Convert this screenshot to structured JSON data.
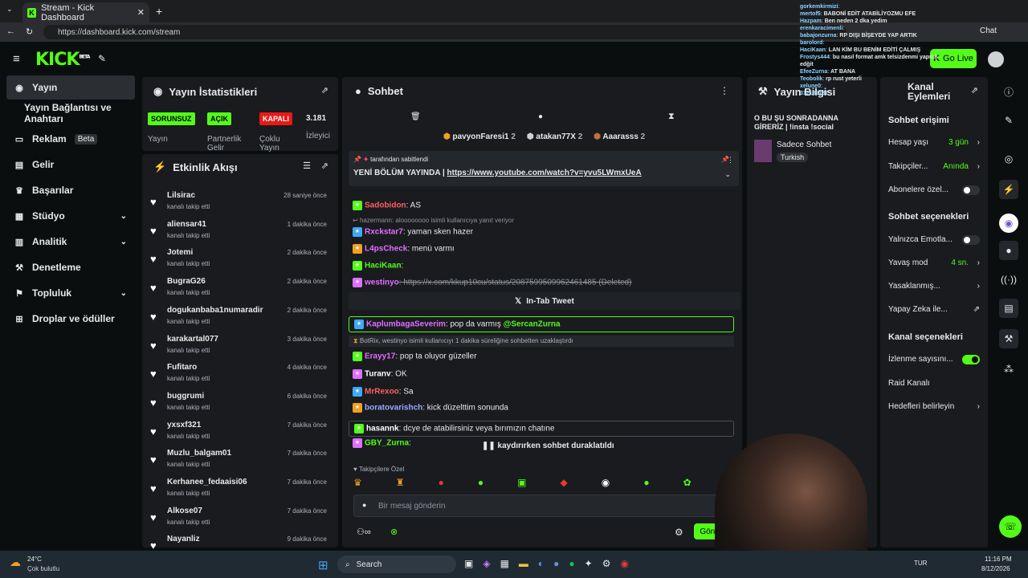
{
  "browser": {
    "tab_title": "Stream - Kick Dashboard",
    "url": "https://dashboard.kick.com/stream",
    "chat_label": "Chat"
  },
  "nav": {
    "logo": "KICK",
    "logo_sup": "BETA",
    "go_live": "Go Live"
  },
  "sidebar": {
    "items": [
      {
        "label": "Yayın",
        "icon": "broadcast-icon"
      },
      {
        "label": "Yayın Bağlantısı ve Anahtarı",
        "icon": ""
      },
      {
        "label": "Reklam",
        "icon": "ad-icon",
        "badge": "Beta"
      },
      {
        "label": "Gelir",
        "icon": "revenue-icon"
      },
      {
        "label": "Başarılar",
        "icon": "trophy-icon"
      },
      {
        "label": "Stüdyo",
        "icon": "studio-icon",
        "chevron": true
      },
      {
        "label": "Analitik",
        "icon": "analytics-icon",
        "chevron": true
      },
      {
        "label": "Denetleme",
        "icon": "wrench-icon"
      },
      {
        "label": "Topluluk",
        "icon": "community-icon",
        "chevron": true
      },
      {
        "label": "Droplar ve ödüller",
        "icon": "gift-icon"
      }
    ]
  },
  "stats": {
    "title": "Yayın İstatistikleri",
    "pills": [
      "SORUNSUZ",
      "AÇIK",
      "KAPALI"
    ],
    "labels": [
      "Yayın",
      "Partnerlik Gelir",
      "Çoklu Yayın",
      "İzleyici"
    ],
    "viewers": "3.181"
  },
  "feed": {
    "title": "Etkinlik Akışı",
    "items": [
      {
        "name": "Lilsirac",
        "sub": "kanalı takip etti",
        "time": "28 saniye önce"
      },
      {
        "name": "aliensar41",
        "sub": "kanalı takip etti",
        "time": "1 dakika önce"
      },
      {
        "name": "Jotemi",
        "sub": "kanalı takip etti",
        "time": "2 dakika önce"
      },
      {
        "name": "BugraG26",
        "sub": "kanalı takip etti",
        "time": "2 dakika önce"
      },
      {
        "name": "dogukanbaba1numaradir",
        "sub": "kanalı takip etti",
        "time": "2 dakika önce"
      },
      {
        "name": "karakartal077",
        "sub": "kanalı takip etti",
        "time": "3 dakika önce"
      },
      {
        "name": "Fufitaro",
        "sub": "kanalı takip etti",
        "time": "4 dakika önce"
      },
      {
        "name": "buggrumi",
        "sub": "kanalı takip etti",
        "time": "6 dakika önce"
      },
      {
        "name": "yxsxf321",
        "sub": "kanalı takip etti",
        "time": "7 dakika önce"
      },
      {
        "name": "Muzlu_balgam01",
        "sub": "kanalı takip etti",
        "time": "7 dakika önce"
      },
      {
        "name": "Kerhanee_fedaaisi06",
        "sub": "kanalı takip etti",
        "time": "7 dakika önce"
      },
      {
        "name": "Alkose07",
        "sub": "kanalı takip etti",
        "time": "7 dakika önce"
      },
      {
        "name": "Nayanliz",
        "sub": "",
        "time": "9 dakika önce"
      }
    ]
  },
  "chat": {
    "title": "Sohbet",
    "leaders": [
      {
        "name": "pavyonFaresi1",
        "n": "2"
      },
      {
        "name": "atakan77X",
        "n": "2"
      },
      {
        "name": "Aaarasss",
        "n": "2"
      }
    ],
    "pinned_by": "tarafından sabitlendi",
    "pinned_text": "YENİ BÖLÜM YAYINDA |",
    "pinned_link": "https://www.youtube.com/watch?v=yvu5LWmxUeA",
    "messages": [
      {
        "user": "Sadobidon",
        "text": ": AS",
        "color": "#ff5f5f"
      },
      {
        "reply": "hazermann: aloooooooo isimli kullanıcıya yanıt veriyor"
      },
      {
        "user": "Rxckstar7",
        "text": ": yaman sken hazer",
        "color": "#e06fff"
      },
      {
        "user": "L4psCheck",
        "text": ": menü varmı",
        "color": "#e06fff"
      },
      {
        "user": "HaciKaan",
        "text": ":",
        "color": "#53fc18"
      },
      {
        "user": "westinyo",
        "text": ": https://x.com/kkup10cu/status/2087599509962461485 (Deleted)",
        "color": "#e06fff"
      },
      {
        "user": "KaplumbagaSeverim",
        "text": ": pop da varmış",
        "mention": "@SercanZurna",
        "color": "#e06fff"
      },
      {
        "system": "BotRix, westinyo isimli kullanıcıyı 1 dakika süreliğine sohbetten uzaklaştırdı"
      },
      {
        "user": "Erayy17",
        "text": ": pop ta oluyor güzeller",
        "color": "#e06fff"
      },
      {
        "user": "Turanv",
        "text": ": OK",
        "color": "#ffffff"
      },
      {
        "user": "MrRexoo",
        "text": ": Sa",
        "color": "#ff5f5f"
      },
      {
        "user": "boratovarishch",
        "text": ": kick düzelttim sonunda",
        "color": "#9aa9ff"
      },
      {
        "user": "hasannk",
        "text": ": dcye de atabilirsiniz veya bırımızın chatıne",
        "color": "#ffffff"
      },
      {
        "user": "GBY_Zurna",
        "text": ":",
        "color": "#53fc18"
      }
    ],
    "tweet": "In-Tab Tweet",
    "paused": "kaydırırken sohbet duraklatıldı",
    "followers_only": "Takipçilere Özel",
    "placeholder": "Bir mesaj gönderin",
    "send": "Gönder"
  },
  "channel": {
    "title": "Yayın Bilgisi",
    "stream_title": "O BU ŞU SONRADANNA GİRERİZ | !insta !social",
    "category": "Sadece Sohbet",
    "tag": "Turkish"
  },
  "actions": {
    "title": "Kanal Eylemleri",
    "sections": [
      {
        "header": "Sohbet erişimi",
        "rows": [
          {
            "label": "Hesap yaşı",
            "value": "3 gün",
            "arrow": true
          },
          {
            "label": "Takipçiler...",
            "value": "Anında",
            "arrow": true
          },
          {
            "label": "Abonelere özel...",
            "toggle": false
          }
        ]
      },
      {
        "header": "Sohbet seçenekleri",
        "rows": [
          {
            "label": "Yalnızca Emotla...",
            "toggle": false
          },
          {
            "label": "Yavaş mod",
            "value": "4 sn.",
            "arrow": true
          },
          {
            "label": "Yasaklanmış...",
            "arrow": true
          },
          {
            "label": "Yapay Zeka ile...",
            "ext": true
          }
        ]
      },
      {
        "header": "Kanal seçenekleri",
        "rows": [
          {
            "label": "İzlenme sayısını...",
            "toggle": true
          },
          {
            "label": "Raid Kanalı"
          },
          {
            "label": "Hedefleri belirleyin",
            "arrow": true
          }
        ]
      }
    ]
  },
  "taskbar": {
    "temp": "24°C",
    "weather": "Çok bulutlu",
    "search": "Search",
    "lang": "TUR",
    "time": "11:16 PM",
    "date": "8/12/2026"
  },
  "overlay": [
    {
      "u": "gorkemkirmizi",
      "t": ""
    },
    {
      "u": "mertof5",
      "t": "BABONİ EDİT ATABİLİYOZMU EFE"
    },
    {
      "u": "Hazpam",
      "t": "Ben neden 2 dka yedim"
    },
    {
      "u": "erenkaracimenli",
      "t": ""
    },
    {
      "u": "babajonzurna",
      "t": "RP DIŞI BİŞEYDE YAP ARTIK"
    },
    {
      "u": "barolord",
      "t": ""
    },
    {
      "u": "HaciKaan",
      "t": "LAN KİM BU BENİM EDİTİ ÇALMIŞ"
    },
    {
      "u": "Frostys444",
      "t": "bu nasıl format amk telsizdenmi yapıldı edğit"
    },
    {
      "u": "EfeeZurna",
      "t": "AT BANA"
    },
    {
      "u": "Teobolik",
      "t": "rp rust yeterli"
    },
    {
      "u": "xelune0",
      "t": ""
    },
    {
      "u": "312132131",
      "t": ""
    }
  ]
}
